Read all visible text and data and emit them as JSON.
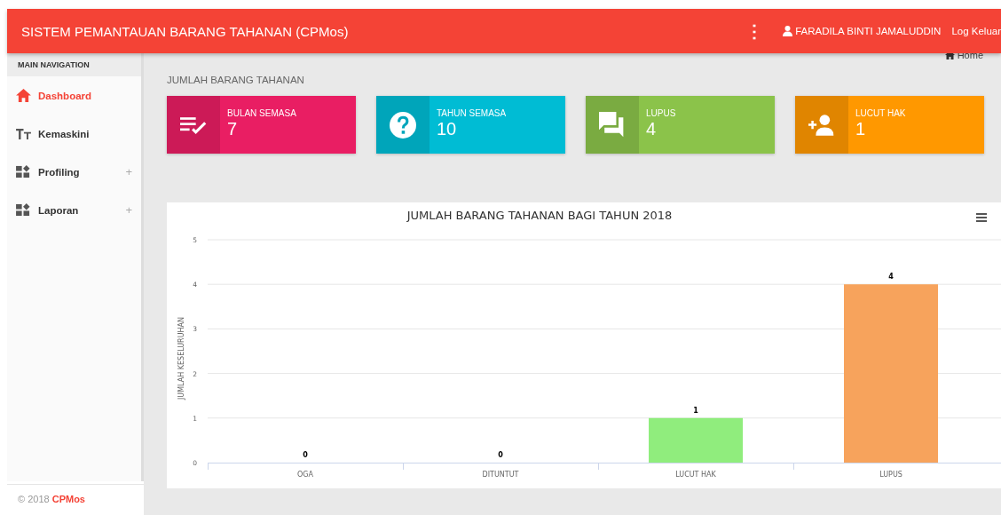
{
  "header": {
    "title": "SISTEM PEMANTAUAN BARANG TAHANAN (CPMos)",
    "menu_glyph": "⋮",
    "user": "FARADILA BINTI JAMALUDDIN",
    "logout": "Log Keluar"
  },
  "sidebar": {
    "heading": "MAIN NAVIGATION",
    "items": [
      {
        "label": "Dashboard",
        "selected": true
      },
      {
        "label": "Kemaskini",
        "selected": false
      },
      {
        "label": "Profiling",
        "selected": false,
        "toggle": "+"
      },
      {
        "label": "Laporan",
        "selected": false,
        "toggle": "+"
      }
    ],
    "footer": {
      "copyright": "© 2018",
      "brand": "CPMos"
    }
  },
  "breadcrumb": "Home",
  "section_title": "JUMLAH BARANG TAHANAN",
  "cards": [
    {
      "label": "BULAN SEMASA",
      "value": "7",
      "color": "#e91e63"
    },
    {
      "label": "TAHUN SEMASA",
      "value": "10",
      "color": "#00bcd4"
    },
    {
      "label": "LUPUS",
      "value": "4",
      "color": "#8bc34a"
    },
    {
      "label": "LUCUT HAK",
      "value": "1",
      "color": "#ff9800"
    }
  ],
  "chart": {
    "chart_data": {
      "type": "bar",
      "title": "JUMLAH BARANG TAHANAN BAGI TAHUN 2018",
      "ylabel": "JUMLAH KESELURUHAN",
      "categories": [
        "OGA",
        "DITUNTUT",
        "LUCUT HAK",
        "LUPUS"
      ],
      "values": [
        0,
        0,
        1,
        4
      ],
      "ylim": [
        0,
        5
      ],
      "yticks": [
        0,
        1,
        2,
        3,
        4,
        5
      ],
      "grid": true,
      "data_labels": true
    }
  }
}
